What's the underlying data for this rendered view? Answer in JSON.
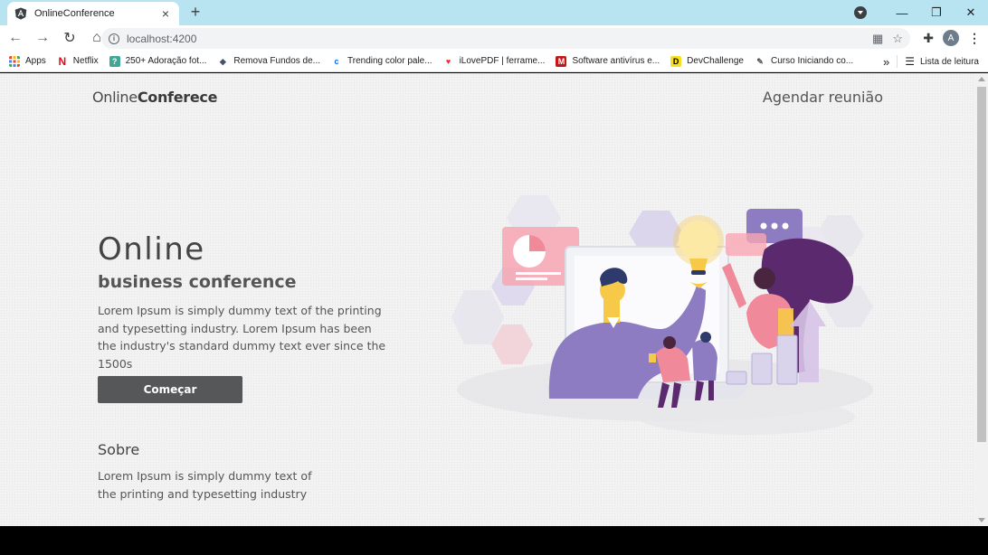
{
  "browser": {
    "tab_title": "OnlineConference",
    "url": "localhost:4200",
    "new_tab": "+",
    "close_tab": "×",
    "avatar_letter": "A",
    "window_controls": {
      "minimize": "—",
      "restore": "❐",
      "close": "✕"
    },
    "bookmarks": [
      {
        "label": "Apps",
        "icon": "apps-grid-icon"
      },
      {
        "label": "Netflix",
        "icon": "netflix-icon"
      },
      {
        "label": "250+ Adoração fot...",
        "icon": "bookmark-green-icon"
      },
      {
        "label": "Remova Fundos de...",
        "icon": "bookmark-layers-icon"
      },
      {
        "label": "Trending color pale...",
        "icon": "bookmark-coolors-icon"
      },
      {
        "label": "iLovePDF | ferrame...",
        "icon": "bookmark-ilovepdf-icon"
      },
      {
        "label": "Software antivírus e...",
        "icon": "bookmark-mcafee-icon"
      },
      {
        "label": "DevChallenge",
        "icon": "bookmark-devchallenge-icon"
      },
      {
        "label": "Curso Iniciando co...",
        "icon": "bookmark-course-icon"
      }
    ],
    "more_bookmarks": "»",
    "reading_list": "Lista de leitura"
  },
  "page": {
    "brand_regular": "Online",
    "brand_bold": "Conferece",
    "nav_link": "Agendar reunião",
    "hero_title": "Online",
    "hero_subtitle": "business conference",
    "hero_text": "Lorem Ipsum is simply dummy text of the printing and typesetting industry. Lorem Ipsum has been the industry's standard dummy text ever since the 1500s",
    "cta_label": "Começar",
    "about_title": "Sobre",
    "about_text": "Lorem Ipsum is simply dummy text of the printing and typesetting industry"
  },
  "colors": {
    "button_bg": "#555759",
    "tabstrip_bg": "#b8e3f1",
    "illustration_purple": "#8e7cc3",
    "illustration_pink": "#f08a9b",
    "illustration_yellow": "#f7c948"
  }
}
